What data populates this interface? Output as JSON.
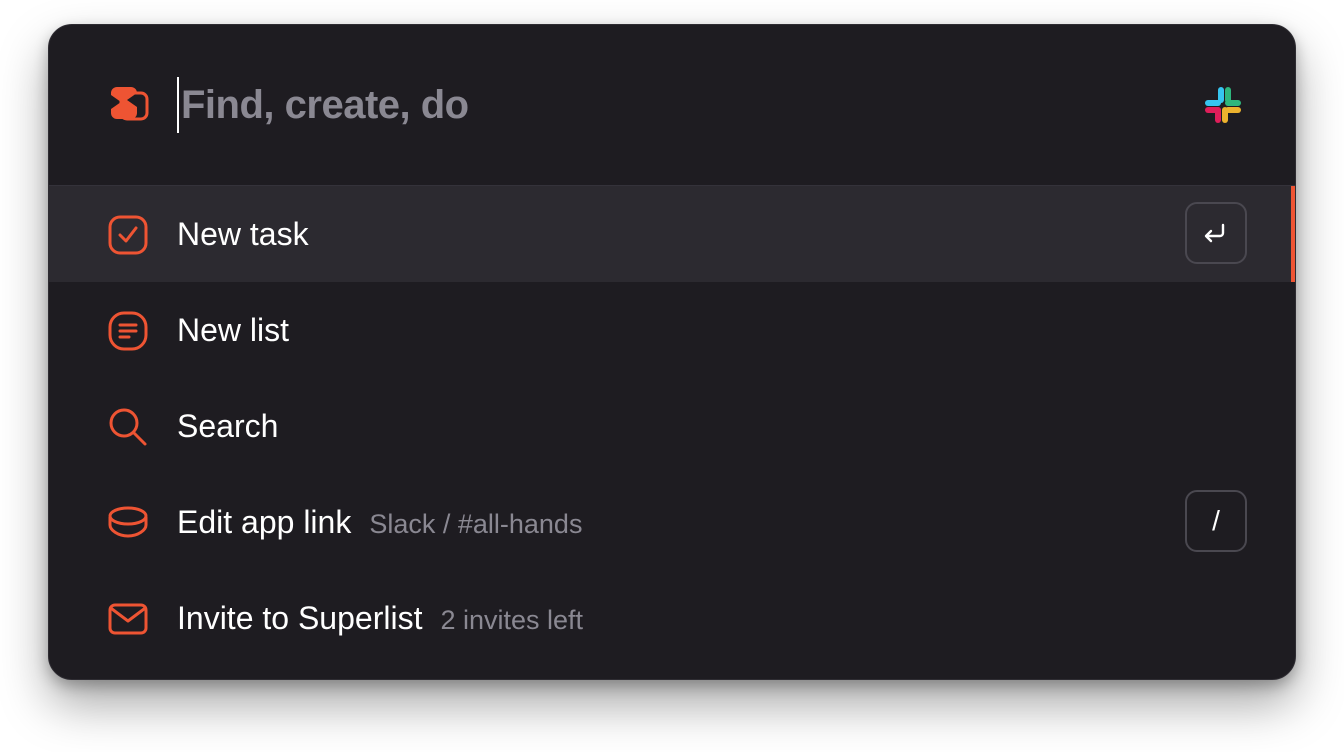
{
  "search": {
    "placeholder": "Find, create, do",
    "value": ""
  },
  "header": {
    "logo_icon": "superlist-logo-icon",
    "integration_icon": "slack-logo-icon"
  },
  "colors": {
    "accent": "#ee5433",
    "background": "#1e1c21",
    "selected_row": "#2c2a30",
    "muted_text": "#8a8892"
  },
  "menu": {
    "items": [
      {
        "icon": "checkbox-icon",
        "label": "New task",
        "sub": "",
        "shortcut": "↵",
        "selected": true
      },
      {
        "icon": "list-icon",
        "label": "New list",
        "sub": "",
        "shortcut": "",
        "selected": false
      },
      {
        "icon": "search-icon",
        "label": "Search",
        "sub": "",
        "shortcut": "",
        "selected": false
      },
      {
        "icon": "stack-icon",
        "label": "Edit app link",
        "sub": "Slack / #all-hands",
        "shortcut": "/",
        "selected": false
      },
      {
        "icon": "mail-icon",
        "label": "Invite to Superlist",
        "sub": "2 invites left",
        "shortcut": "",
        "selected": false
      }
    ]
  }
}
